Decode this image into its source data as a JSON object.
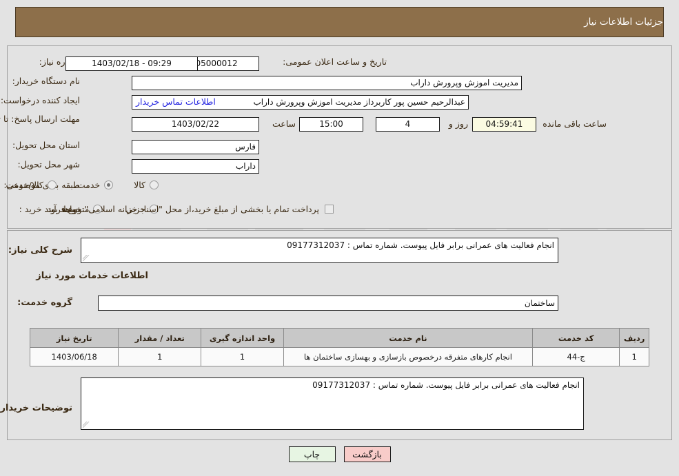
{
  "header": {
    "title": "جزئیات اطلاعات نیاز",
    "bar_color": "#8d6f4a"
  },
  "watermark": {
    "text": "AriaTender.net"
  },
  "top_section": {
    "need_number": {
      "label": "شماره نیاز:",
      "value": "1103004005000012"
    },
    "announce_datetime": {
      "label": "تاریخ و ساعت اعلان عمومی:",
      "value": "1403/02/18 - 09:29"
    },
    "buyer_org": {
      "label": "نام دستگاه خریدار:",
      "value": "مدیریت اموزش وپرورش داراب"
    },
    "request_creator": {
      "label": "ایجاد کننده درخواست:",
      "value": "عبدالرحیم حسین پور کاربرداز مدیریت اموزش وپرورش داراب"
    },
    "buyer_contact_link": {
      "label": "اطلاعات تماس خریدار"
    },
    "reply_deadline": {
      "label": "مهلت ارسال پاسخ: تا تاریخ:",
      "date": "1403/02/22",
      "time_label": "ساعت",
      "time": "15:00",
      "days_value": "4",
      "days_label": "روز و",
      "countdown": "04:59:41",
      "countdown_label": "ساعت باقی مانده"
    },
    "delivery_province": {
      "label": "استان محل تحویل:",
      "value": "فارس"
    },
    "delivery_city": {
      "label": "شهر محل تحویل:",
      "value": "داراب"
    },
    "subject_classification": {
      "label": "طبقه بندی موضوعی:",
      "options": [
        {
          "text": "کالا",
          "selected": false
        },
        {
          "text": "خدمت",
          "selected": true
        },
        {
          "text": "کالا/خدمت",
          "selected": false
        }
      ]
    },
    "purchase_process": {
      "label": "نوع فرآیند خرید :",
      "options": [
        {
          "text": "جزیی",
          "selected": false,
          "type": "radio"
        },
        {
          "text": "متوسط",
          "selected": false,
          "type": "radio"
        }
      ],
      "checkbox": {
        "text": "پرداخت تمام یا بخشی از مبلغ خرید،از محل \"اسناد خزانه اسلامی\" خواهد بود.",
        "checked": false
      }
    }
  },
  "bottom_section": {
    "general_need": {
      "label": "شرح کلی نیاز:",
      "value": "انجام فعالیت های عمرانی برابر فایل پیوست. شماره تماس : 09177312037"
    },
    "services_heading": "اطلاعات خدمات مورد نیاز",
    "service_group": {
      "label": "گروه خدمت:",
      "value": "ساختمان"
    },
    "table": {
      "columns": [
        "ردیف",
        "کد خدمت",
        "نام خدمت",
        "واحد اندازه گیری",
        "تعداد / مقدار",
        "تاریخ نیاز"
      ],
      "rows": [
        {
          "row_no": "1",
          "service_code": "ج-44",
          "service_name": "انجام کارهای متفرقه درخصوص بازسازی و بهسازی ساختمان ها",
          "unit": "1",
          "quantity": "1",
          "need_date": "1403/06/18"
        }
      ]
    },
    "buyer_notes": {
      "label": "توضیحات خریدار:",
      "value": "انجام فعالیت های عمرانی برابر فایل پیوست. شماره تماس : 09177312037"
    }
  },
  "buttons": {
    "print": "چاپ",
    "back": "بازگشت"
  }
}
